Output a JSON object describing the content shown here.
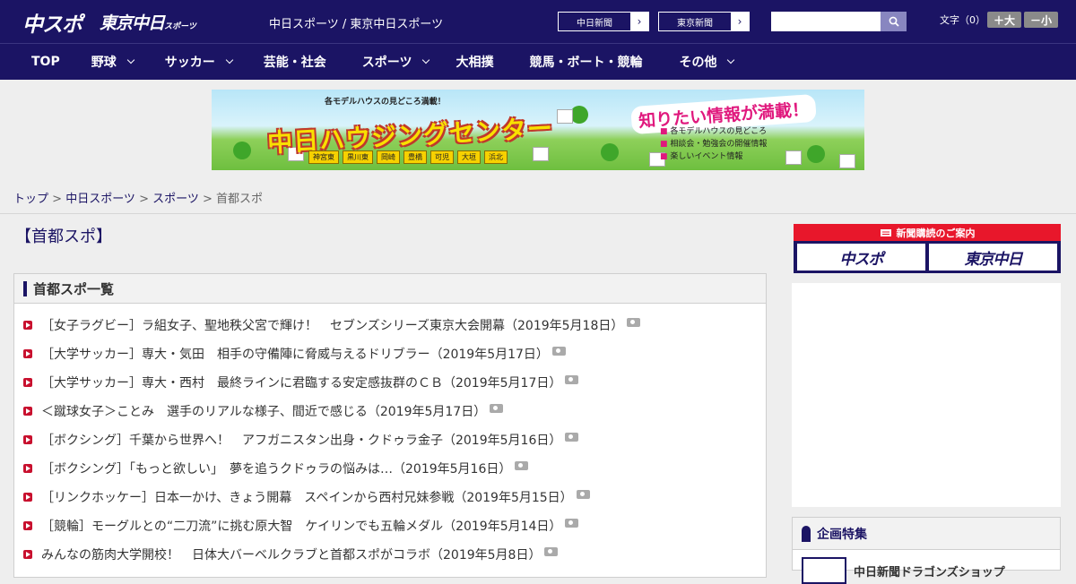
{
  "header": {
    "logo_chuspo": "中スポ",
    "logo_tokyo": "東京中日",
    "logo_tokyo_small": "スポーツ",
    "tagline": "中日スポーツ / 東京中日スポーツ",
    "btn_chunichi": "中日新聞",
    "btn_tokyo": "東京新聞",
    "search_placeholder": "",
    "fontsize_label": "文字（0）",
    "font_bigger": "＋大",
    "font_smaller": "－小"
  },
  "nav": [
    {
      "label": "TOP"
    },
    {
      "label": "野球"
    },
    {
      "label": "サッカー"
    },
    {
      "label": "芸能・社会"
    },
    {
      "label": "スポーツ"
    },
    {
      "label": "大相撲"
    },
    {
      "label": "競馬・ボート・競輪"
    },
    {
      "label": "その他"
    }
  ],
  "banner": {
    "top_text": "各モデルハウスの見どころ満載！",
    "main_text": "中日ハウジングセンター",
    "bubble": "知りたい情報が満載！",
    "tags": [
      "神宮東",
      "黒川東",
      "岡崎",
      "豊橋",
      "可児",
      "大垣",
      "浜北"
    ],
    "list": [
      "各モデルハウスの見どころ",
      "相談会・勉強会の開催情報",
      "楽しいイベント情報"
    ]
  },
  "breadcrumb": {
    "top": "トップ",
    "chunichi": "中日スポーツ",
    "sports": "スポーツ",
    "current": "首都スポ",
    "sep": " > "
  },
  "main": {
    "title": "【首都スポ】",
    "panel_title": "首都スポ一覧",
    "items": [
      "［女子ラグビー］ラ組女子、聖地秩父宮で輝け！　セブンズシリーズ東京大会開幕（2019年5月18日）",
      "［大学サッカー］専大・気田　相手の守備陣に脅威与えるドリブラー（2019年5月17日）",
      "［大学サッカー］専大・西村　最終ラインに君臨する安定感抜群のＣＢ（2019年5月17日）",
      "＜蹴球女子＞ことみ　選手のリアルな様子、間近で感じる（2019年5月17日）",
      "［ボクシング］千葉から世界へ！　アフガニスタン出身・クドゥラ金子（2019年5月16日）",
      "［ボクシング］「もっと欲しい」　夢を追うクドゥラの悩みは…（2019年5月16日）",
      "［リンクホッケー］日本一かけ、きょう開幕　スペインから西村兄妹参戦（2019年5月15日）",
      "［競輪］モーグルとの“二刀流”に挑む原大智　ケイリンでも五輪メダル（2019年5月14日）",
      "みんなの筋肉大学開校！　日体大バーベルクラブと首都スポがコラボ（2019年5月8日）"
    ]
  },
  "sidebar": {
    "subscribe_header": "新聞購読のご案内",
    "subscribe_chuspo": "中スポ",
    "subscribe_tokyo": "東京中日",
    "feature_title": "企画特集",
    "feature_item": "中日新聞ドラゴンズショップ"
  },
  "colors": {
    "brand_navy": "#1b1464",
    "accent_red": "#c8102e"
  }
}
